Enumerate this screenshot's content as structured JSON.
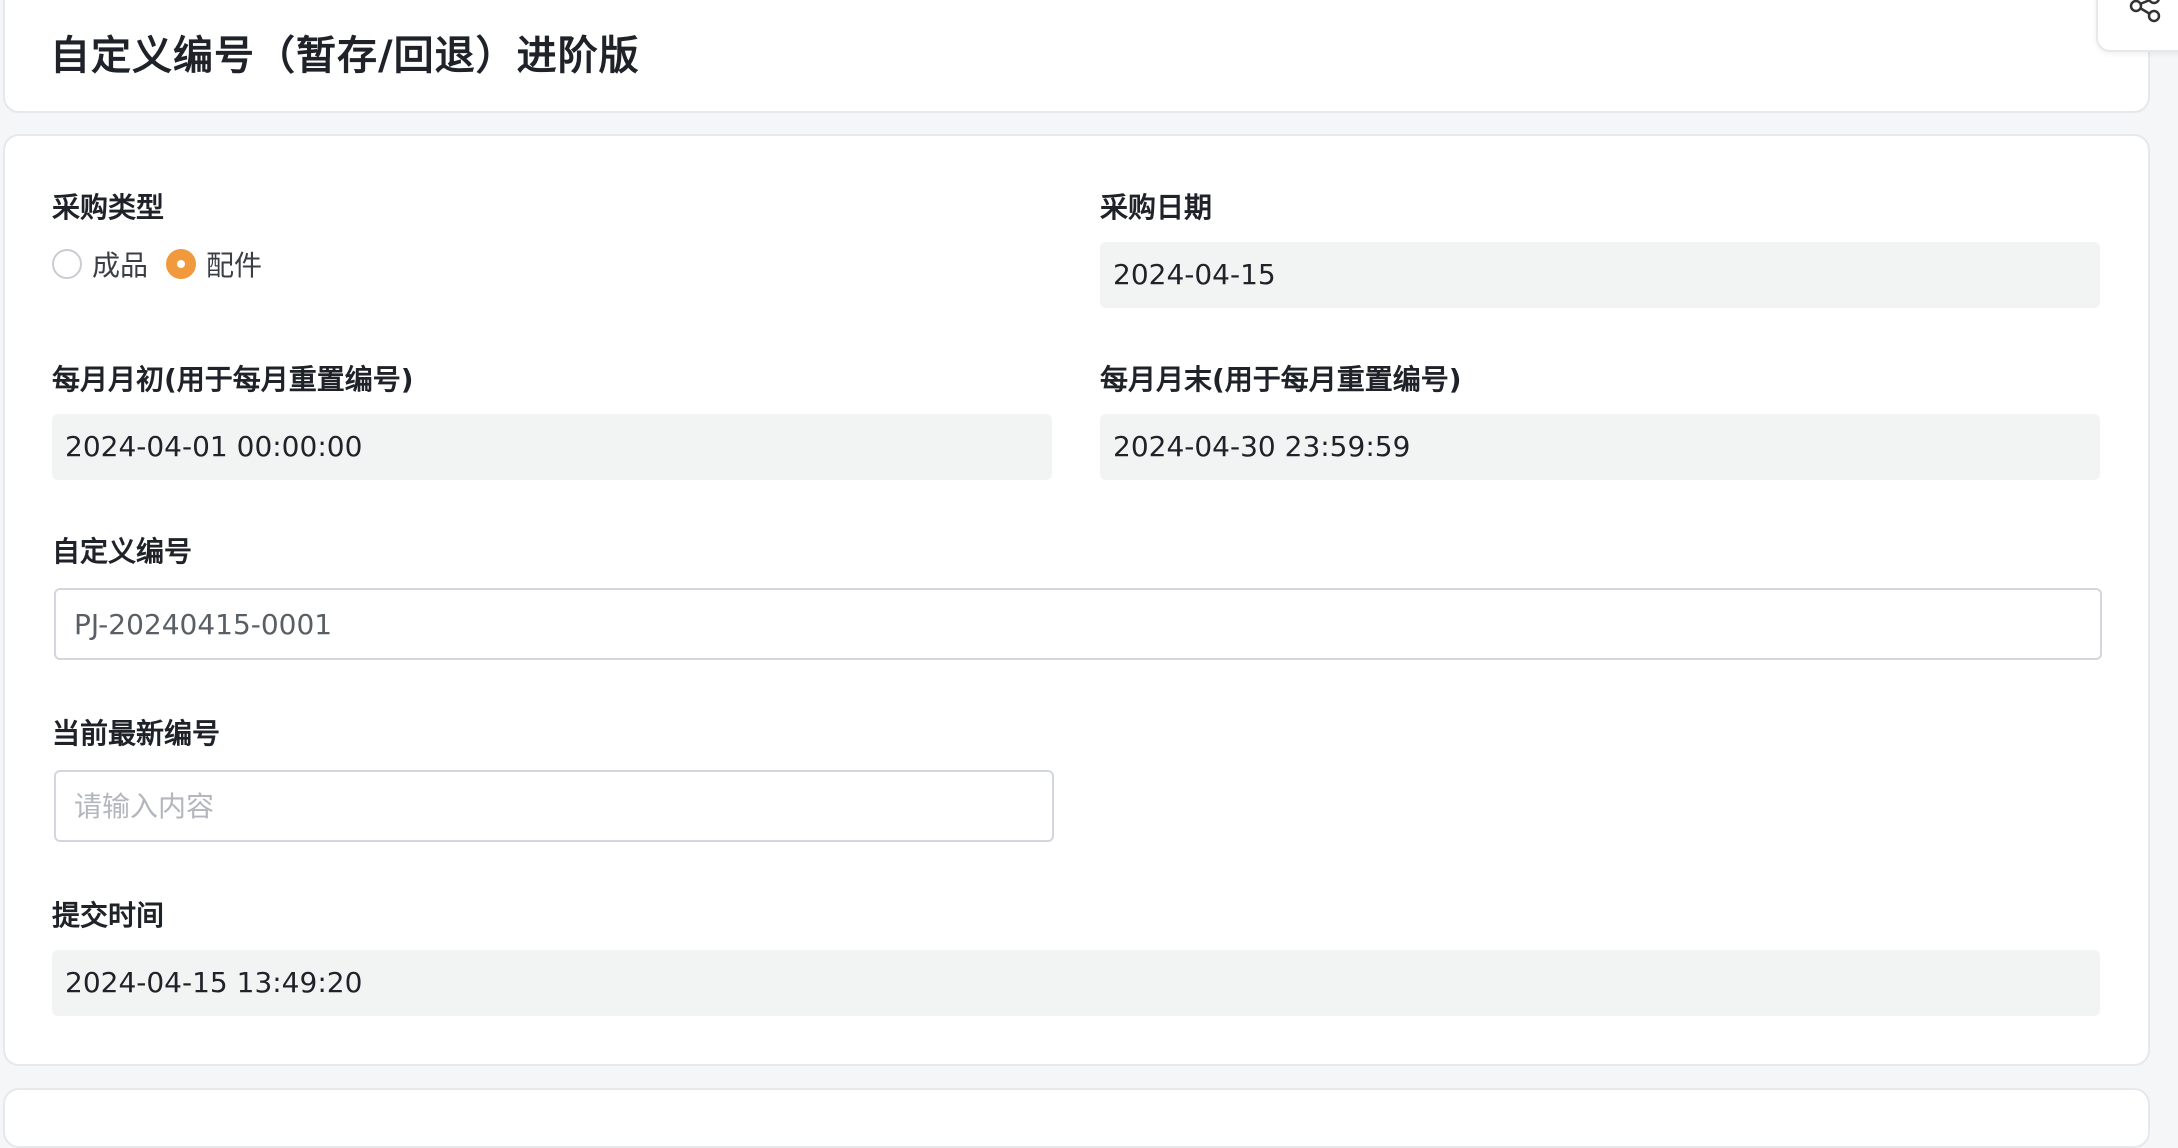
{
  "page": {
    "title": "自定义编号（暂存/回退）进阶版"
  },
  "toolbar": {
    "share_icon": "share-icon"
  },
  "form": {
    "purchase_type": {
      "label": "采购类型",
      "options": [
        {
          "label": "成品",
          "checked": false
        },
        {
          "label": "配件",
          "checked": true
        }
      ]
    },
    "purchase_date": {
      "label": "采购日期",
      "value": "2024-04-15"
    },
    "month_start": {
      "label": "每月月初(用于每月重置编号)",
      "value": "2024-04-01 00:00:00"
    },
    "month_end": {
      "label": "每月月末(用于每月重置编号)",
      "value": "2024-04-30 23:59:59"
    },
    "custom_number": {
      "label": "自定义编号",
      "value": "PJ-20240415-0001"
    },
    "latest_number": {
      "label": "当前最新编号",
      "value": "",
      "placeholder": "请输入内容"
    },
    "submit_time": {
      "label": "提交时间",
      "value": "2024-04-15 13:49:20"
    }
  },
  "colors": {
    "accent": "#f0993d",
    "readonly_bg": "#f2f3f3",
    "border": "#d3d6dc"
  }
}
